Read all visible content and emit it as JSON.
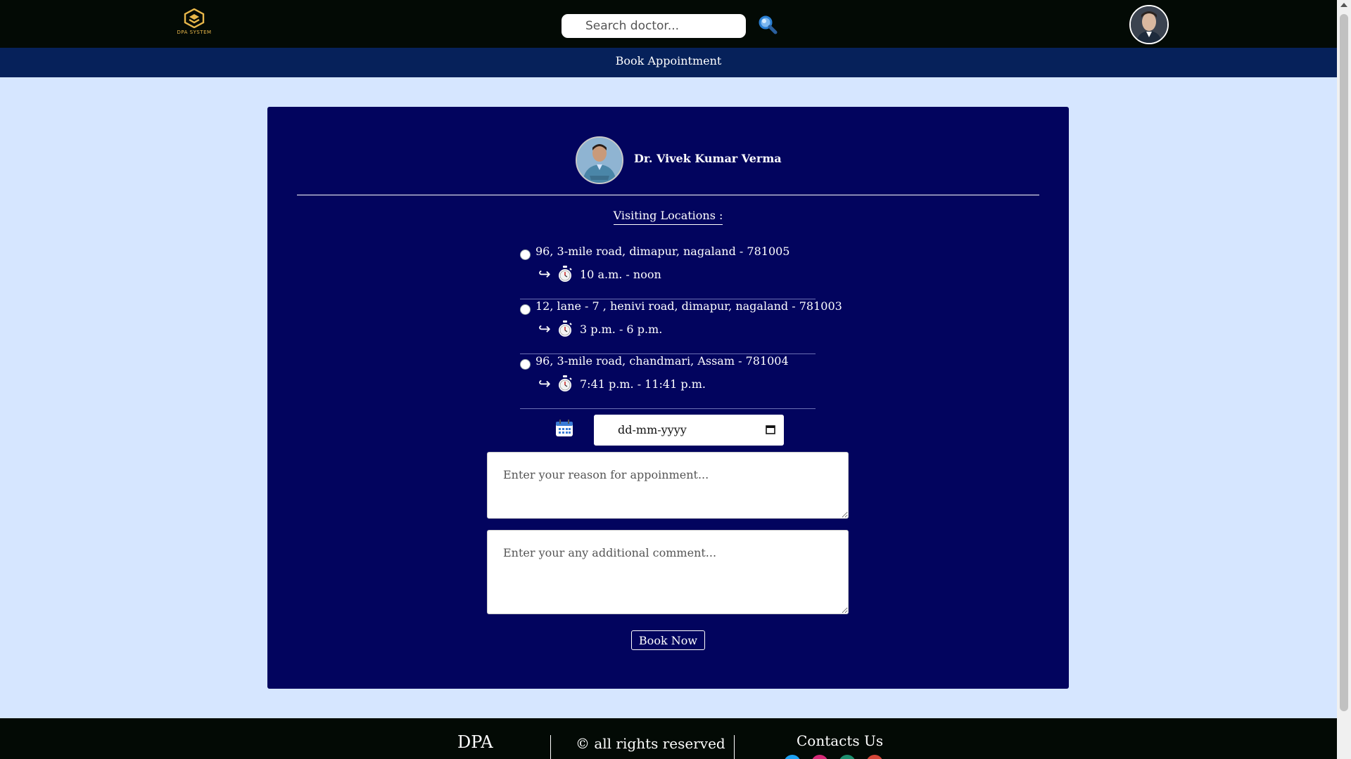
{
  "header": {
    "logo_text": "DPA SYSTEM",
    "search_placeholder": "Search doctor...",
    "search_icon": "magnifier-icon",
    "avatar": "user-avatar"
  },
  "subnav": {
    "link_label": "Book Appointment"
  },
  "doctor": {
    "name": "Dr. Vivek Kumar Verma"
  },
  "visiting": {
    "title": "Visiting Locations :",
    "locations": [
      {
        "address": "96, 3-mile road, dimapur, nagaland - 781005",
        "time": "10 a.m. - noon"
      },
      {
        "address": "12, lane - 7 , henivi road, dimapur, nagaland - 781003",
        "time": "3 p.m. - 6 p.m."
      },
      {
        "address": "96, 3-mile road, chandmari, Assam - 781004",
        "time": "7:41 p.m. - 11:41 p.m."
      }
    ],
    "arrow_glyph": "↪"
  },
  "form": {
    "date_placeholder": "dd-mm-yyyy",
    "reason_placeholder": "Enter your reason for appoinment...",
    "comment_placeholder": "Enter your any additional comment...",
    "submit_label": "Book Now"
  },
  "footer": {
    "brand": "DPA",
    "rights": "© all rights reserved",
    "contact_title": "Contacts Us"
  },
  "colors": {
    "nav_bg": "#030a05",
    "subnav_bg": "#06215a",
    "page_bg": "#d6e6ff",
    "card_bg": "#02045e",
    "logo_gold": "#e8b74a"
  }
}
